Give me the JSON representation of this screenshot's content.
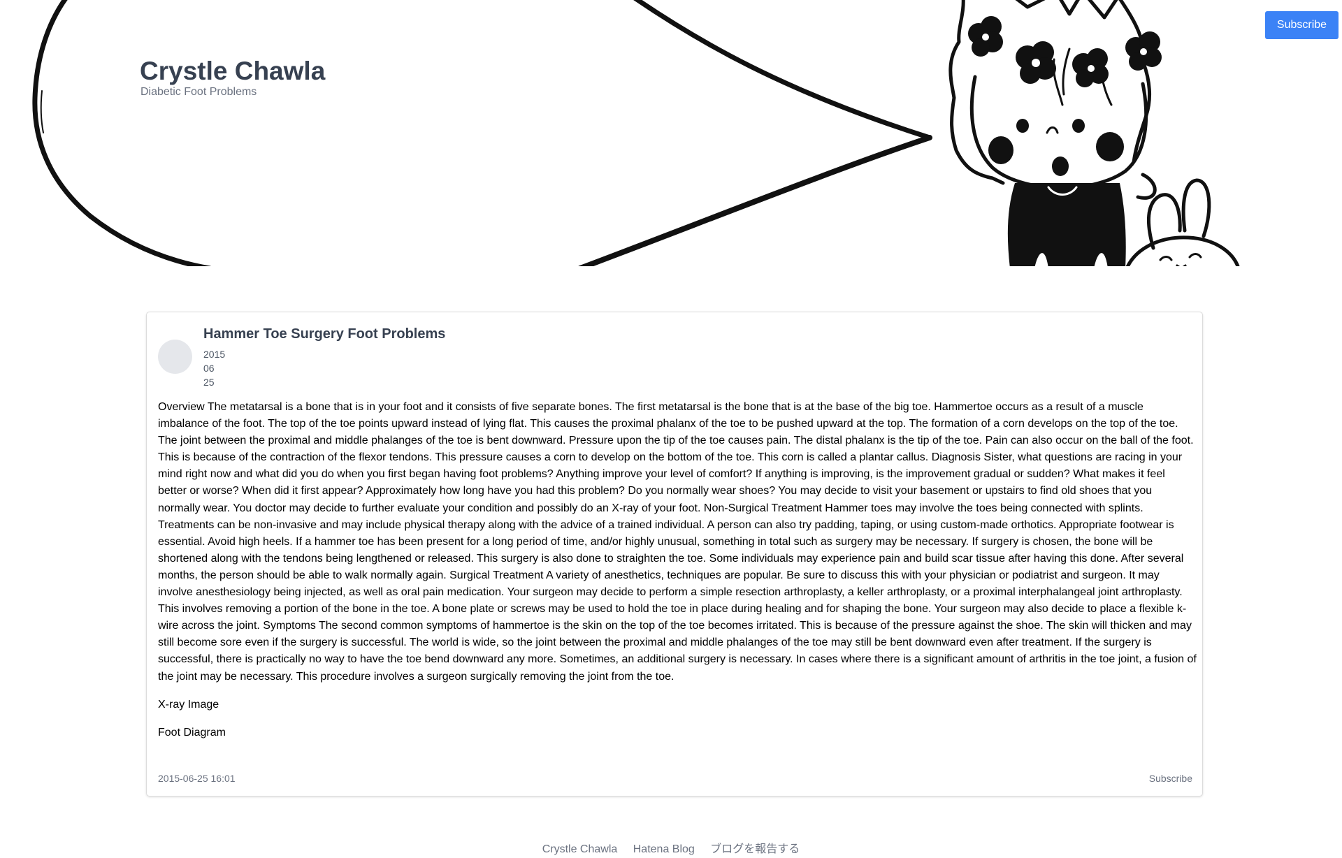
{
  "header": {
    "blog_title": "Crystle Chawla",
    "blog_description": "Diabetic Foot Problems",
    "subscribe_label": "Subscribe",
    "accent_color": "#3b82f6",
    "header_image": "manga-girl-speech-bubble-illustration"
  },
  "entry": {
    "title": "Hammer Toe Surgery Foot Problems",
    "date": {
      "year": "2015",
      "month": "06",
      "day": "25"
    },
    "body": "Overview The metatarsal is a bone that is in your foot and it consists of five separate bones. The first metatarsal is the bone that is at the base of the big toe. Hammertoe occurs as a result of a muscle imbalance of the foot. The top of the toe points upward instead of lying flat. This causes the proximal phalanx of the toe to be pushed upward at the top. The formation of a corn develops on the top of the toe. The joint between the proximal and middle phalanges of the toe is bent downward. Pressure upon the tip of the toe causes pain. The distal phalanx is the tip of the toe. Pain can also occur on the ball of the foot. This is because of the contraction of the flexor tendons. This pressure causes a corn to develop on the bottom of the toe. This corn is called a plantar callus. Diagnosis Sister, what questions are racing in your mind right now and what did you do when you first began having foot problems? Anything improve your level of comfort? If anything is improving, is the improvement gradual or sudden? What makes it feel better or worse? When did it first appear? Approximately how long have you had this problem? Do you normally wear shoes? You may decide to visit your basement or upstairs to find old shoes that you normally wear. You doctor may decide to further evaluate your condition and possibly do an X-ray of your foot. Non-Surgical Treatment Hammer toes may involve the toes being connected with splints. Treatments can be non-invasive and may include physical therapy along with the advice of a trained individual. A person can also try padding, taping, or using custom-made orthotics. Appropriate footwear is essential. Avoid high heels. If a hammer toe has been present for a long period of time, and/or highly unusual, something in total such as surgery may be necessary. If surgery is chosen, the bone will be shortened along with the tendons being lengthened or released. This surgery is also done to straighten the toe. Some individuals may experience pain and build scar tissue after having this done. After several months, the person should be able to walk normally again. Surgical Treatment A variety of anesthetics, techniques are popular. Be sure to discuss this with your physician or podiatrist and surgeon. It may involve anesthesiology being injected, as well as oral pain medication. Your surgeon may decide to perform a simple resection arthroplasty, a keller arthroplasty, or a proximal interphalangeal joint arthroplasty. This involves removing a portion of the bone in the toe. A bone plate or screws may be used to hold the toe in place during healing and for shaping the bone. Your surgeon may also decide to place a flexible k-wire across the joint. Symptoms The second common symptoms of hammertoe is the skin on the top of the toe becomes irritated. This is because of the pressure against the shoe. The skin will thicken and may still become sore even if the surgery is successful. The world is wide, so the joint between the proximal and middle phalanges of the toe may still be bent downward even after treatment. If the surgery is successful, there is practically no way to have the toe bend downward any more. Sometimes, an additional surgery is necessary. In cases where there is a significant amount of arthritis in the toe joint, a fusion of the joint may be necessary. This procedure involves a surgeon surgically removing the joint from the toe.",
    "image_caption_1": "X-ray Image",
    "image_caption_2": "Foot Diagram",
    "timestamp": "2015-06-25 16:01",
    "subscribe_label": "Subscribe"
  },
  "footer": {
    "links": [
      "Crystle Chawla",
      "Hatena Blog",
      "ブログを報告する"
    ]
  }
}
